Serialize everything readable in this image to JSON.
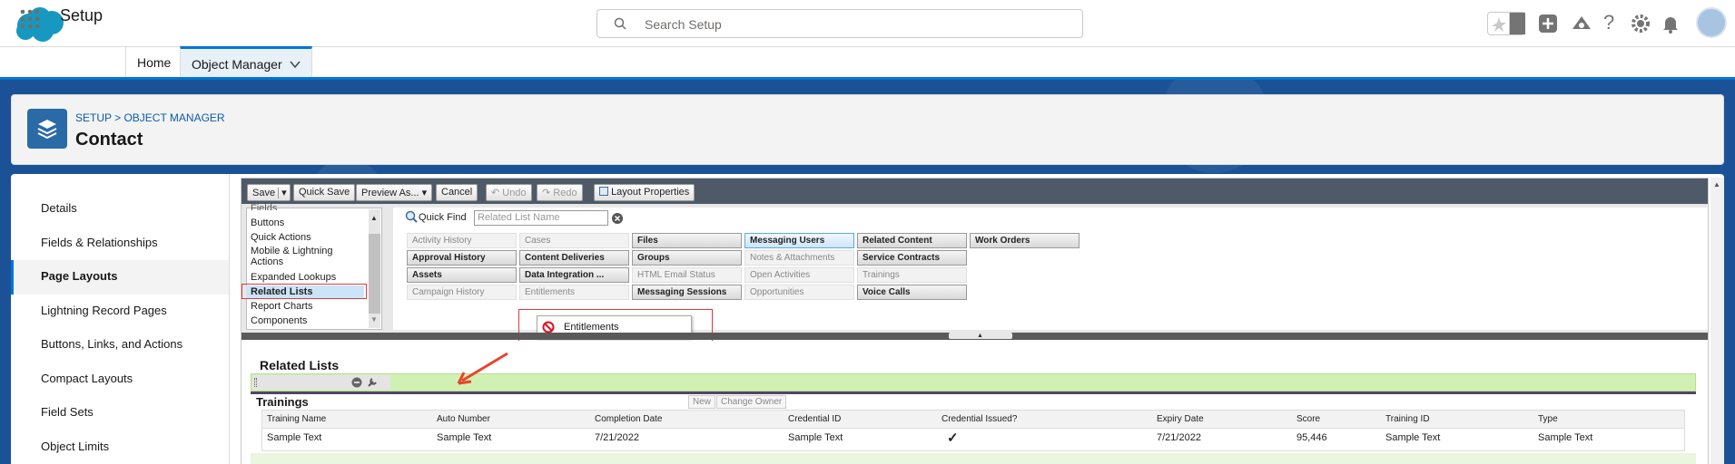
{
  "search": {
    "placeholder": "Search Setup"
  },
  "nav": {
    "app_name": "Setup",
    "tabs": [
      {
        "label": "Home"
      },
      {
        "label": "Object Manager"
      }
    ]
  },
  "header": {
    "breadcrumb": "SETUP > OBJECT MANAGER",
    "title": "Contact"
  },
  "sidebar": {
    "items": [
      {
        "label": "Details"
      },
      {
        "label": "Fields & Relationships"
      },
      {
        "label": "Page Layouts"
      },
      {
        "label": "Lightning Record Pages"
      },
      {
        "label": "Buttons, Links, and Actions"
      },
      {
        "label": "Compact Layouts"
      },
      {
        "label": "Field Sets"
      },
      {
        "label": "Object Limits"
      }
    ]
  },
  "toolbar": {
    "save": "Save",
    "quick_save": "Quick Save",
    "preview_as": "Preview As...",
    "cancel": "Cancel",
    "undo": "Undo",
    "redo": "Redo",
    "layout_properties": "Layout Properties"
  },
  "palette": {
    "categories": [
      "Fields",
      "Buttons",
      "Quick Actions",
      "Mobile & Lightning Actions",
      "Expanded Lookups",
      "Related Lists",
      "Report Charts",
      "Components"
    ],
    "selected_category": "Related Lists",
    "quick_find_label": "Quick Find",
    "quick_find_placeholder": "Related List Name",
    "items": {
      "activity_history": "Activity History",
      "cases": "Cases",
      "files": "Files",
      "messaging_users": "Messaging Users",
      "related_content": "Related Content",
      "work_orders": "Work Orders",
      "approval_history": "Approval History",
      "content_deliveries": "Content Deliveries",
      "groups": "Groups",
      "notes_attachments": "Notes & Attachments",
      "service_contracts": "Service Contracts",
      "assets": "Assets",
      "data_integration": "Data Integration ...",
      "html_email_status": "HTML Email Status",
      "open_activities": "Open Activities",
      "trainings": "Trainings",
      "campaign_history": "Campaign History",
      "entitlements": "Entitlements",
      "messaging_sessions": "Messaging Sessions",
      "opportunities": "Opportunities",
      "voice_calls": "Voice Calls"
    },
    "tooltip": "Entitlements"
  },
  "layout": {
    "section_title": "Related Lists",
    "related_list": {
      "title": "Trainings",
      "buttons": [
        "New",
        "Change Owner"
      ],
      "columns": [
        "Training Name",
        "Auto Number",
        "Completion Date",
        "Credential ID",
        "Credential Issued?",
        "Expiry Date",
        "Score",
        "Training ID",
        "Type"
      ],
      "row": [
        "Sample Text",
        "Sample Text",
        "7/21/2022",
        "Sample Text",
        "✓",
        "7/21/2022",
        "95,446",
        "Sample Text",
        "Sample Text"
      ]
    }
  },
  "colors": {
    "brand": "#0176d3",
    "highlight_red": "#e03a3a",
    "drop_zone": "#d1f0b4"
  }
}
